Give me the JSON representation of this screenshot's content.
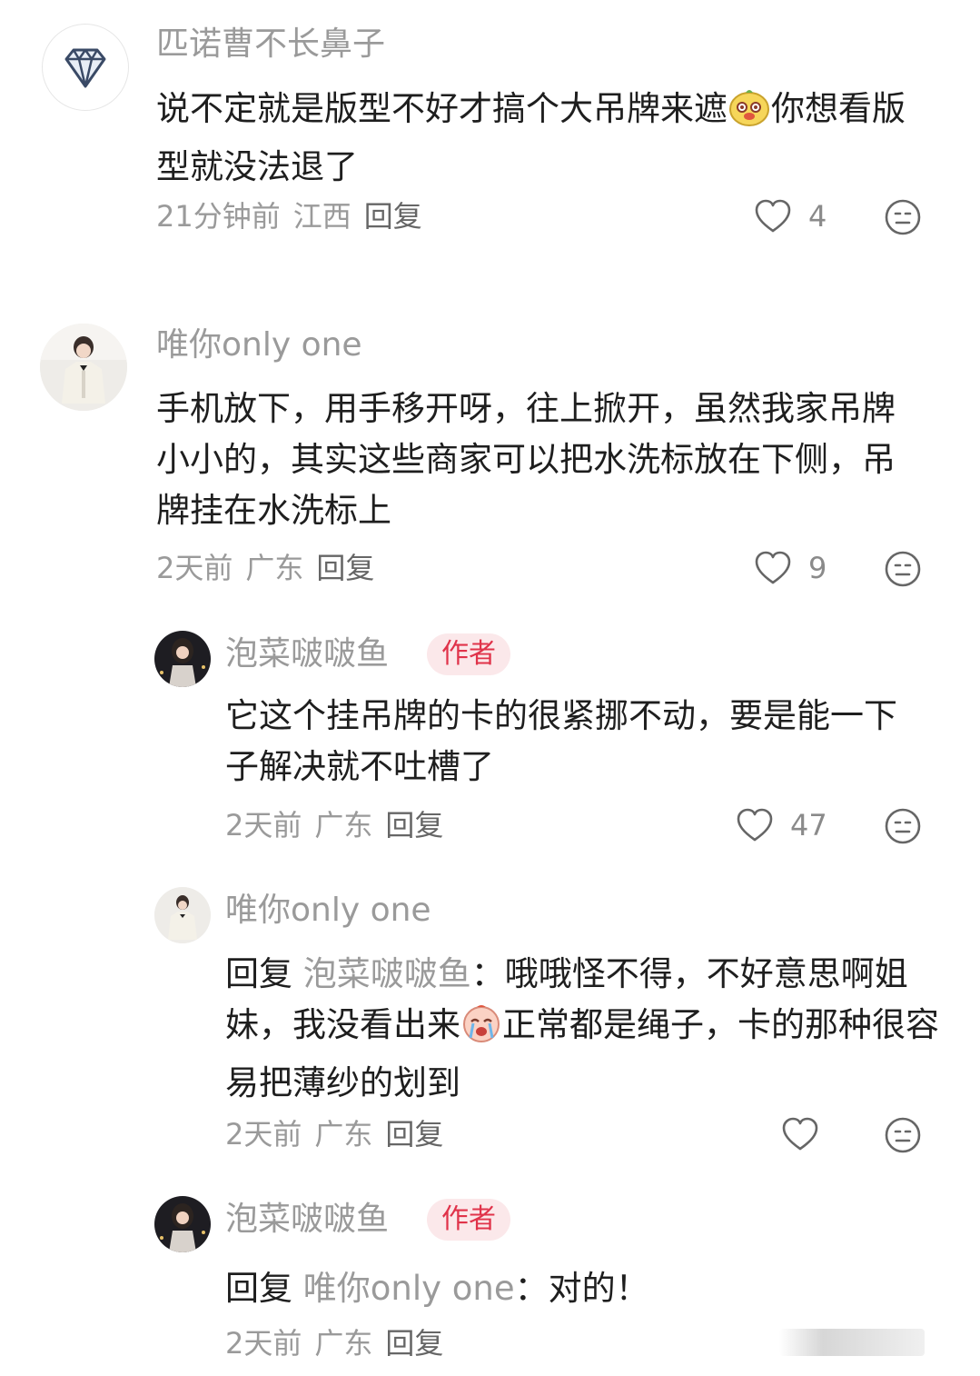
{
  "comments": [
    {
      "name": "匹诺曹不长鼻子",
      "text_a": "说不定就是版型不好才搞个大吊牌来遮",
      "emoji": "doge-emoji",
      "text_b": "你想看版型就没法退了",
      "time": "21分钟前",
      "region": "江西",
      "reply_label": "回复",
      "likes": "4"
    },
    {
      "name": "唯你only one",
      "text": "手机放下，用手移开呀，往上掀开，虽然我家吊牌小小的，其实这些商家可以把水洗标放在下侧，吊牌挂在水洗标上",
      "time": "2天前",
      "region": "广东",
      "reply_label": "回复",
      "likes": "9"
    },
    {
      "name": "泡菜啵啵鱼",
      "badge": "作者",
      "text": "它这个挂吊牌的卡的很紧挪不动，要是能一下子解决就不吐槽了",
      "time": "2天前",
      "region": "广东",
      "reply_label": "回复",
      "likes": "47"
    },
    {
      "name": "唯你only one",
      "reply_prefix": "回复",
      "mention": "泡菜啵啵鱼",
      "text_a": "：哦哦怪不得，不好意思啊姐妹，我没看出来",
      "emoji": "crying-emoji",
      "text_b": "正常都是绳子，卡的那种很容易把薄纱的划到",
      "time": "2天前",
      "region": "广东",
      "reply_label": "回复",
      "likes": ""
    },
    {
      "name": "泡菜啵啵鱼",
      "badge": "作者",
      "reply_prefix": "回复",
      "mention": "唯你only one",
      "text_a": "：对的！",
      "time": "2天前",
      "region": "广东",
      "reply_label": "回复"
    }
  ],
  "colors": {
    "name": "#9a9a9a",
    "badge_bg": "#fbe8ea",
    "badge_text": "#e0334a",
    "text": "#1e1e1e",
    "meta": "#9a9a9a"
  }
}
